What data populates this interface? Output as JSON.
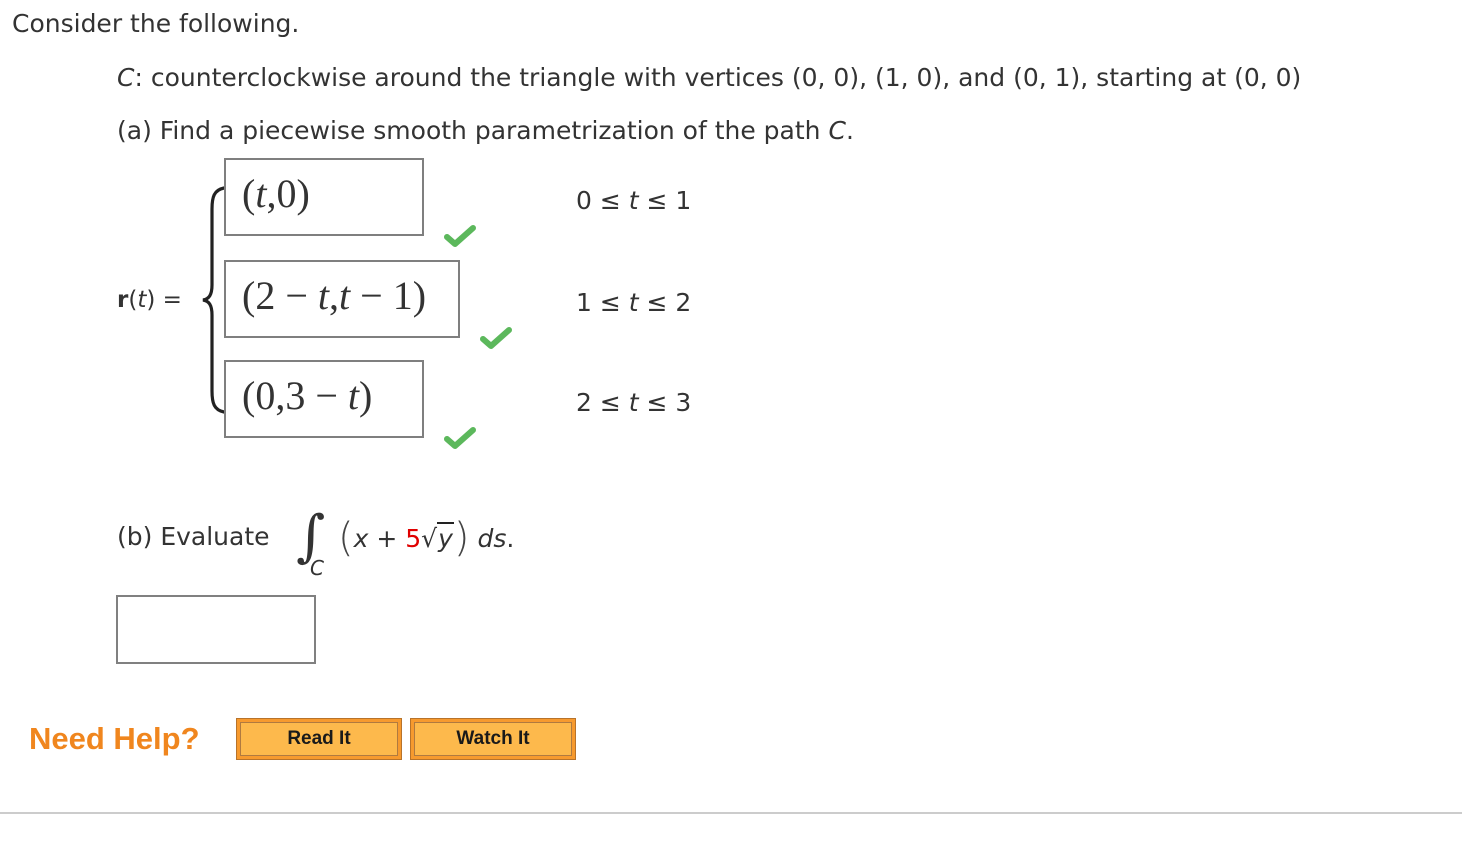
{
  "intro": "Consider the following.",
  "curve": {
    "symbol": "C",
    "description": ": counterclockwise around the triangle with vertices (0, 0), (1, 0), and (0, 1), starting at (0, 0)"
  },
  "part_a": {
    "prefix": "(a) Find a piecewise smooth parametrization of the path ",
    "symbol": "C",
    "suffix": ".",
    "r_label": {
      "bold": "r",
      "open": "(",
      "var": "t",
      "close": ")",
      "eq": " ="
    },
    "pieces": [
      {
        "answer": "(t,0)",
        "math_parts": [
          "(",
          "t",
          ",0",
          ")"
        ],
        "range_left": "0 ≤ ",
        "range_var": "t",
        "range_right": " ≤ 1",
        "status": "correct"
      },
      {
        "answer": "(2 − t,t − 1)",
        "math_parts": [
          "(2 − ",
          "t",
          ",",
          "t",
          " − 1)"
        ],
        "range_left": "1 ≤ ",
        "range_var": "t",
        "range_right": " ≤ 2",
        "status": "correct"
      },
      {
        "answer": "(0,3 − t)",
        "math_parts": [
          "(0,3 − ",
          "t",
          ")"
        ],
        "range_left": "2 ≤ ",
        "range_var": "t",
        "range_right": " ≤ 3",
        "status": "correct"
      }
    ]
  },
  "part_b": {
    "label": "(b) Evaluate",
    "integral_subscript": "C",
    "integrand": {
      "x": "x",
      "plus": " + ",
      "coef": "5",
      "radicand": "y",
      "ds": "ds",
      "period": "."
    },
    "answer_value": ""
  },
  "help": {
    "label": "Need Help?",
    "read_it": "Read It",
    "watch_it": "Watch It"
  },
  "colors": {
    "check_green": "#5cb85c",
    "help_orange": "#f0861e",
    "button_fill": "#fdb94c",
    "coef_red": "#e00000"
  }
}
